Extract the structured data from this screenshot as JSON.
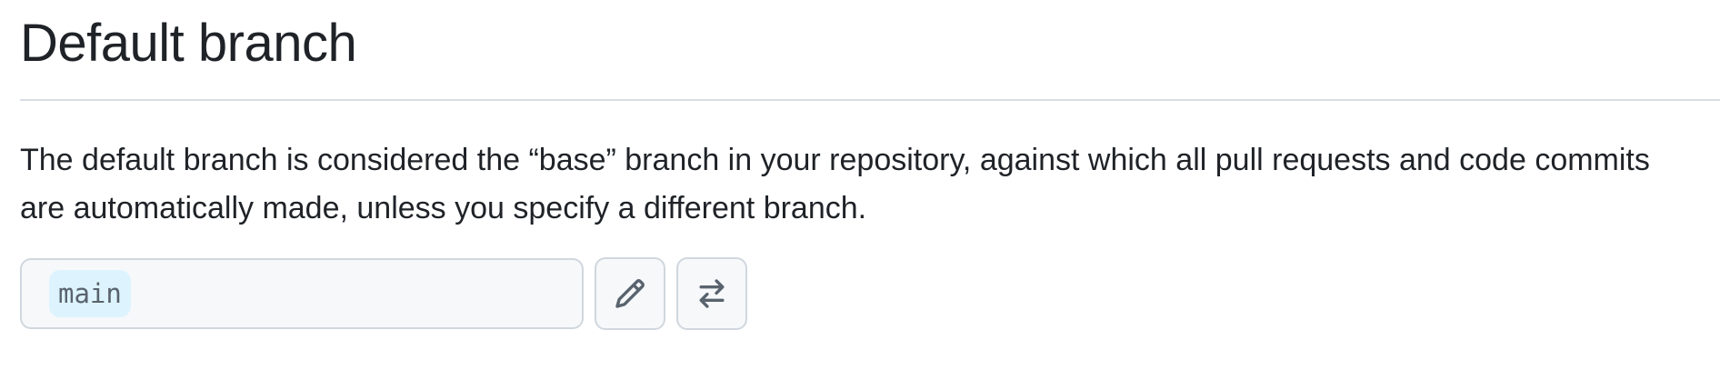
{
  "section": {
    "title": "Default branch",
    "description": "The default branch is considered the “base” branch in your repository, against which all pull requests and code commits are automatically made, unless you specify a different branch."
  },
  "branch": {
    "current": "main"
  },
  "actions": {
    "rename": {
      "icon": "pencil-icon"
    },
    "switch": {
      "icon": "arrow-switch-icon"
    }
  },
  "colors": {
    "text": "#1f2328",
    "border": "#d0d7de",
    "divider": "#d8dee4",
    "box_background": "#f6f8fa",
    "branch_badge_background": "#ddf4ff",
    "icon": "#59636e"
  }
}
